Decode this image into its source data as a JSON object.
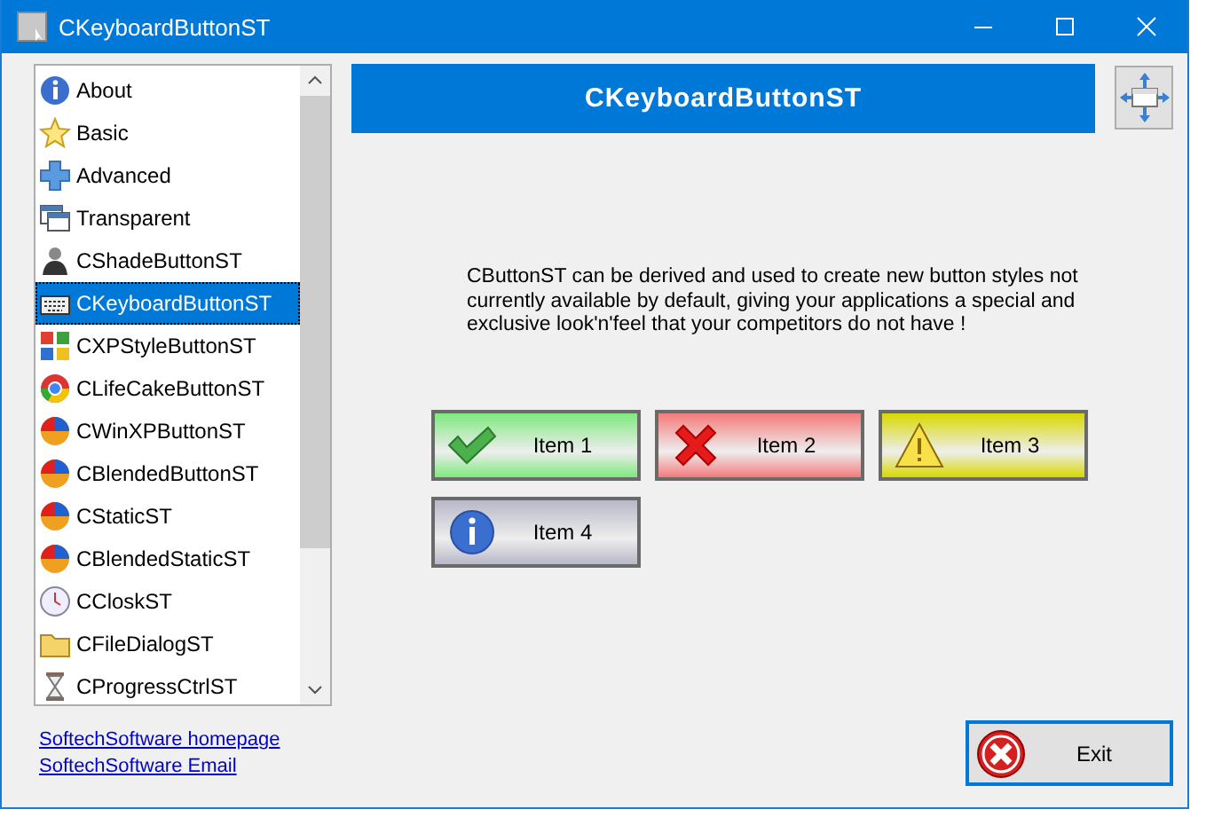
{
  "window": {
    "title": "CKeyboardButtonST"
  },
  "sidebar": {
    "items": [
      {
        "label": "About",
        "kind": "info",
        "selected": false
      },
      {
        "label": "Basic",
        "kind": "star",
        "selected": false
      },
      {
        "label": "Advanced",
        "kind": "plus",
        "selected": false
      },
      {
        "label": "Transparent",
        "kind": "windows",
        "selected": false
      },
      {
        "label": "CShadeButtonST",
        "kind": "person",
        "selected": false
      },
      {
        "label": "CKeyboardButtonST",
        "kind": "keyboard",
        "selected": true
      },
      {
        "label": "CXPStyleButtonST",
        "kind": "tiles",
        "selected": false
      },
      {
        "label": "CLifeCakeButtonST",
        "kind": "ring",
        "selected": false
      },
      {
        "label": "CWinXPButtonST",
        "kind": "ball",
        "selected": false
      },
      {
        "label": "CBlendedButtonST",
        "kind": "ball",
        "selected": false
      },
      {
        "label": "CStaticST",
        "kind": "ball",
        "selected": false
      },
      {
        "label": "CBlendedStaticST",
        "kind": "ball",
        "selected": false
      },
      {
        "label": "CCloskST",
        "kind": "clock",
        "selected": false
      },
      {
        "label": "CFileDialogST",
        "kind": "folder",
        "selected": false
      },
      {
        "label": "CProgressCtrlST",
        "kind": "hourglass",
        "selected": false
      }
    ]
  },
  "header": {
    "title": "CKeyboardButtonST"
  },
  "description": "CButtonST can be derived and used to create new button styles not currently available by default, giving your applications a special and exclusive look'n'feel that your competitors do not have !",
  "buttons": [
    {
      "label": "Item 1",
      "kind": "check",
      "color": "#7ee87e"
    },
    {
      "label": "Item 2",
      "kind": "cross",
      "color": "#f47a7a"
    },
    {
      "label": "Item 3",
      "kind": "warning",
      "color": "#d8d800"
    },
    {
      "label": "Item 4",
      "kind": "info",
      "color": "#b8b8c8"
    }
  ],
  "links": [
    "SoftechSoftware homepage",
    "SoftechSoftware Email"
  ],
  "exit_button": {
    "label": "Exit"
  }
}
